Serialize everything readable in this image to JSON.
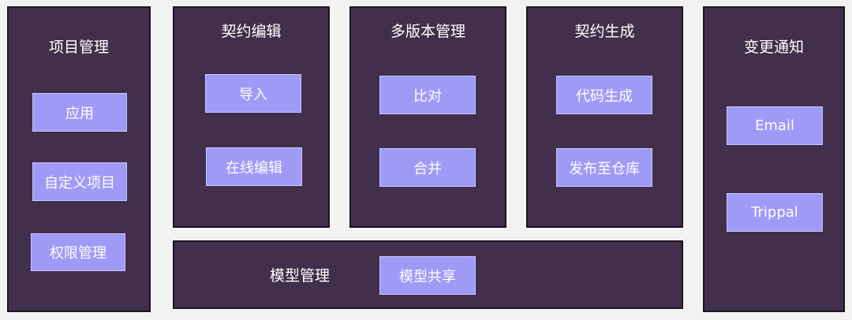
{
  "colors": {
    "background": "#f2f2f2",
    "panel": "#422f4c",
    "panel_border": "#1c1320",
    "button": "#a09af7",
    "text": "#ffffff"
  },
  "project_management": {
    "title": "项目管理",
    "items": [
      "应用",
      "自定义项目",
      "权限管理"
    ]
  },
  "contract_edit": {
    "title": "契约编辑",
    "items": [
      "导入",
      "在线编辑"
    ]
  },
  "multi_version": {
    "title": "多版本管理",
    "items": [
      "比对",
      "合并"
    ]
  },
  "contract_generate": {
    "title": "契约生成",
    "items": [
      "代码生成",
      "发布至仓库"
    ]
  },
  "change_notify": {
    "title": "变更通知",
    "items": [
      "Email",
      "Trippal"
    ]
  },
  "model_management": {
    "title": "模型管理",
    "items": [
      "模型共享"
    ]
  }
}
